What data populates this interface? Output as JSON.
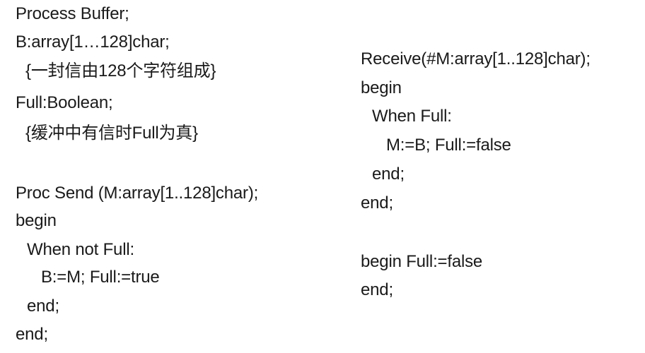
{
  "left_block": {
    "lines": [
      "Process Buffer;",
      "B:array[1…128]char;",
      "{一封信由128个字符组成}",
      "Full:Boolean;",
      "{缓冲中有信时Full为真}",
      "Proc Send (M:array[1..128]char);",
      "begin",
      "When not Full:",
      "B:=M; Full:=true",
      "end;",
      "end;"
    ]
  },
  "right_block": {
    "lines": [
      "Receive(#M:array[1..128]char);",
      "begin",
      "When Full:",
      "M:=B; Full:=false",
      "end;",
      "end;",
      "begin Full:=false",
      "end;"
    ]
  }
}
